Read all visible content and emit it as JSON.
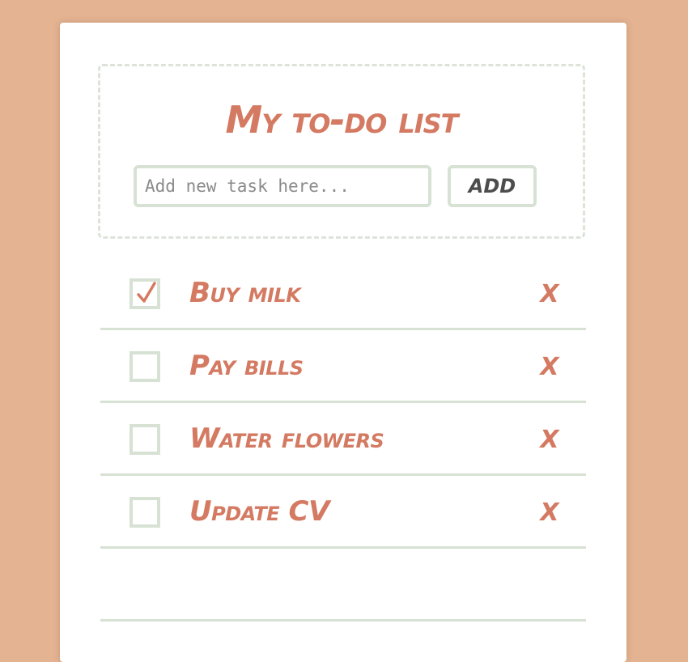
{
  "header": {
    "title": "My to-do list",
    "input_placeholder": "Add new task here...",
    "input_value": "",
    "add_label": "ADD"
  },
  "todos": [
    {
      "label": "Buy milk",
      "checked": true,
      "delete_label": "X"
    },
    {
      "label": "Pay bills",
      "checked": false,
      "delete_label": "X"
    },
    {
      "label": "Water flowers",
      "checked": false,
      "delete_label": "X"
    },
    {
      "label": "Update CV",
      "checked": false,
      "delete_label": "X"
    }
  ],
  "colors": {
    "background": "#e3b392",
    "accent": "#d47a62",
    "border": "#d7e2d4",
    "card": "#ffffff"
  },
  "icons": {
    "checkmark": "checkmark-icon",
    "delete": "x-icon"
  }
}
